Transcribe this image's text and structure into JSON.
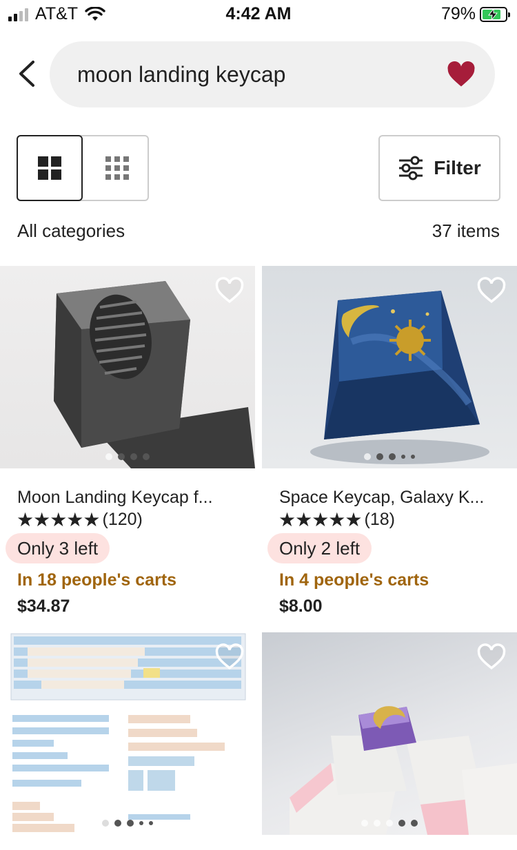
{
  "status_bar": {
    "carrier": "AT&T",
    "time": "4:42 AM",
    "battery": "79%"
  },
  "search": {
    "query": "moon landing keycap"
  },
  "filter": {
    "label": "Filter"
  },
  "results": {
    "category": "All categories",
    "count": "37 items"
  },
  "products": [
    {
      "title": "Moon Landing Keycap f...",
      "stars": "★★★★★",
      "reviews": "(120)",
      "stock": "Only 3 left",
      "carts": "In 18 people's carts",
      "price": "$34.87"
    },
    {
      "title": "Space Keycap, Galaxy K...",
      "stars": "★★★★★",
      "reviews": "(18)",
      "stock": "Only 2 left",
      "carts": "In 4 people's carts",
      "price": "$8.00"
    }
  ],
  "colors": {
    "favorite_heart": "#a61d3a",
    "carts_text": "#a0650e",
    "stock_badge_bg": "#fde2e0",
    "search_bg": "#f0f0f0"
  }
}
